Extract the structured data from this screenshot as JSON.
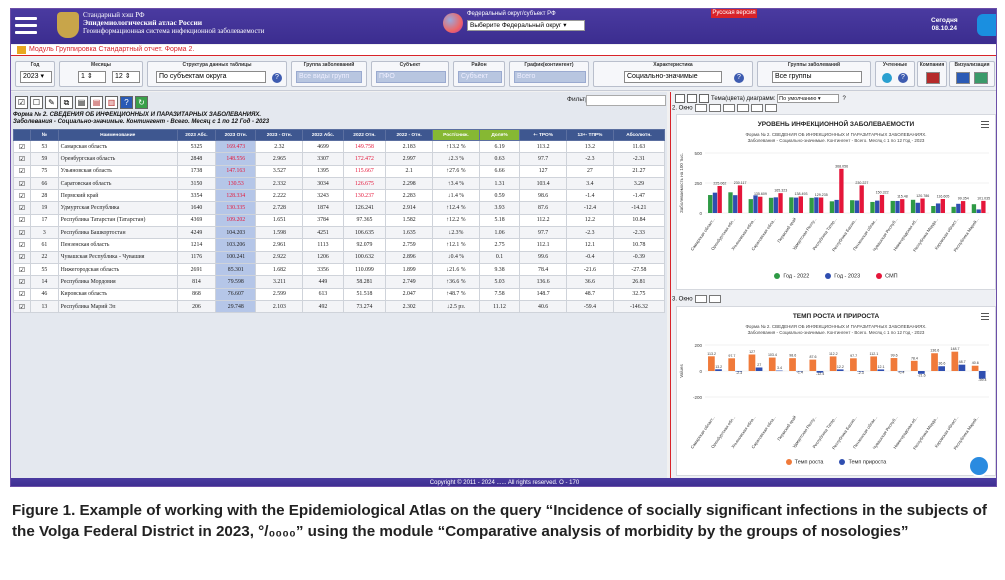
{
  "header": {
    "title_line1": "Стандарный хэш РФ",
    "title_line2": "Эпидемиологический атлас России",
    "title_line3": "Геоинформационная система инфекционной заболеваемости",
    "district_label": "Федеральный округ/субъект РФ",
    "district_select": "Выберите Федеральный округ",
    "badge": "Русская версия",
    "today_label": "Сегодня",
    "today_date": "08.10.24"
  },
  "module_bar": "Модуль Группировка Стандартный отчет. Форма 2.",
  "filters": {
    "year_label": "Год",
    "year": "2023",
    "month_label": "Месяцы",
    "month_from": "1",
    "month_to": "12",
    "structure_label": "Структура данных таблицы",
    "structure": "По субъектам округа",
    "disease_group_label": "Группа заболеваний",
    "disease_group": "Все виды групп",
    "subject_label": "Субъект",
    "subject": "ПФО",
    "district_label": "Район",
    "district": "Субъект",
    "grafic_label": "График(контингент)",
    "grafic": "Всего",
    "char_label": "Характеристика",
    "char": "Социально-значимые",
    "diseases_group2_label": "Группы заболеваний",
    "diseases_group2": "Все группы",
    "accounting_label": "Учтенные",
    "company_label": "Компания",
    "visualization_label": "Визуализация"
  },
  "table": {
    "filter_label": "Фильтр:",
    "form_title": "Форма № 2. СВЕДЕНИЯ ОБ ИНФЕКЦИОННЫХ И ПАРАЗИТАРНЫХ ЗАБОЛЕВАНИЯХ.",
    "form_subtitle": "Заболевания - Социально-значимые. Контингент - Всего. Месяц с 1 по 12 Год - 2023",
    "columns": [
      "",
      "№",
      "Наименование",
      "2023 Абс.",
      "2023 Отн.",
      "2023 - Отн.",
      "2022 Абс.",
      "2022 Отн.",
      "2022 - Отн.",
      "Рост/сниж.",
      "Доля%",
      "+- ТРО%",
      "13+- ТПР%",
      "Абсолютн."
    ],
    "rows": [
      [
        "53",
        "Самарская область",
        "5325",
        "169.473",
        "2.32",
        "4699",
        "149.758",
        "2.183",
        "↑13.2 %",
        "6.19",
        "113.2",
        "13.2",
        "11.63"
      ],
      [
        "59",
        "Оренбургская область",
        "2848",
        "148.556",
        "2.965",
        "3307",
        "172.472",
        "2.997",
        "↓2.3 %",
        "0.63",
        "97.7",
        "-2.3",
        "-2.31"
      ],
      [
        "75",
        "Ульяновская область",
        "1738",
        "147.163",
        "3.527",
        "1395",
        "115.667",
        "2.1",
        "↑27.6 %",
        "6.66",
        "127",
        "27",
        "21.27"
      ],
      [
        "66",
        "Саратовская область",
        "3150",
        "130.53",
        "2.332",
        "3034",
        "126.675",
        "2.298",
        "↑3.4 %",
        "1.31",
        "103.4",
        "3.4",
        "3.29"
      ],
      [
        "28",
        "Пермский край",
        "3354",
        "128.334",
        "2.222",
        "3243",
        "130.237",
        "2.283",
        "↓1.4 %",
        "0.59",
        "98.6",
        "-1.4",
        "-1.47"
      ],
      [
        "19",
        "Удмуртская Республика",
        "1640",
        "130.335",
        "2.728",
        "1874",
        "126.241",
        "2.914",
        "↑12.4 %",
        "3.93",
        "87.6",
        "-12.4",
        "-14.21"
      ],
      [
        "17",
        "Республика Татарстан (Татарстан)",
        "4369",
        "109.202",
        "1.651",
        "3784",
        "97.365",
        "1.582",
        "↑12.2 %",
        "5.18",
        "112.2",
        "12.2",
        "10.84"
      ],
      [
        "3",
        "Республика Башкортостан",
        "4249",
        "104.203",
        "1.598",
        "4251",
        "106.635",
        "1.635",
        "↓2.3%",
        "1.06",
        "97.7",
        "-2.3",
        "-2.33"
      ],
      [
        "61",
        "Пензенская область",
        "1214",
        "103.206",
        "2.961",
        "1113",
        "92.079",
        "2.759",
        "↑12.1 %",
        "2.75",
        "112.1",
        "12.1",
        "10.78"
      ],
      [
        "22",
        "Чувашская Республика - Чувашия",
        "1176",
        "100.241",
        "2.922",
        "1206",
        "100.632",
        "2.896",
        "↓0.4 %",
        "0.1",
        "99.6",
        "-0.4",
        "-0.39"
      ],
      [
        "55",
        "Нижегородская область",
        "2691",
        "85.301",
        "1.682",
        "3356",
        "110.099",
        "1.899",
        "↓21.6 %",
        "9.38",
        "78.4",
        "-21.6",
        "-27.58"
      ],
      [
        "14",
        "Республика Мордовия",
        "814",
        "79.598",
        "3.211",
        "449",
        "58.281",
        "2.749",
        "↑36.6 %",
        "5.03",
        "136.6",
        "36.6",
        "26.81"
      ],
      [
        "46",
        "Кировская область",
        "868",
        "76.607",
        "2.599",
        "613",
        "51.518",
        "2.047",
        "↑48.7 %",
        "7.58",
        "148.7",
        "48.7",
        "32.75"
      ],
      [
        "13",
        "Республика Марий Эл",
        "206",
        "29.748",
        "2.103",
        "492",
        "73.274",
        "2.302",
        "↓2.5 рз.",
        "11.12",
        "40.6",
        "-59.4",
        "-146.32"
      ]
    ]
  },
  "right_pane": {
    "toolbar_tail": "Тема(цвета) диаграмм:",
    "theme": "По умолчанию",
    "sub1_label": "2. Окно",
    "sub2_label": "3. Окно"
  },
  "chart1_text": {
    "title": "УРОВЕНЬ ИНФЕКЦИОННОЙ ЗАБОЛЕВАЕМОСТИ",
    "sub1": "Форма № 2. СВЕДЕНИЯ ОБ ИНФЕКЦИОННЫХ И ПАРАЗИТАРНЫХ ЗАБОЛЕВАНИЯХ.",
    "sub2": "Заболевания - Социально-значимые. Контингент - Всего. Месяц с 1 по 12 Год - 2023",
    "ylabel": "Заболеваемость на 100 тыс."
  },
  "chart2_text": {
    "title": "ТЕМП РОСТА И ПРИРОСТА",
    "sub1": "Форма № 2. СВЕДЕНИЯ ОБ ИНФЕКЦИОННЫХ И ПАРАЗИТАРНЫХ ЗАБОЛЕВАНИЯХ.",
    "sub2": "Заболевания - Социально-значимые. Контингент - Всего. Месяц с 1 по 12 Год - 2023",
    "ylabel": "Values"
  },
  "chart_data": [
    {
      "type": "bar",
      "title": "УРОВЕНЬ ИНФЕКЦИОННОЙ ЗАБОЛЕВАЕМОСТИ",
      "ylabel": "Заболеваемость на 100 тыс.",
      "ylim": [
        0,
        500
      ],
      "yticks": [
        0,
        250,
        500
      ],
      "categories": [
        "Самарская област...",
        "Оренбургская обл...",
        "Ульяновская обла...",
        "Саратовская обла...",
        "Пермский край",
        "Удмуртская Респу...",
        "Республика Татар...",
        "Республика Башко...",
        "Пензенская облас...",
        "Чувашская Респуб...",
        "Нижегородская об...",
        "Республика Мордо...",
        "Кировская област...",
        "Республика Марий..."
      ],
      "series": [
        {
          "name": "Год - 2022",
          "color": "#2e9a45",
          "values": [
            149.758,
            172.472,
            115.667,
            126.675,
            130.237,
            126.241,
            97.365,
            106.635,
            92.079,
            100.632,
            110.099,
            58.281,
            51.518,
            73.274
          ]
        },
        {
          "name": "Год - 2023",
          "color": "#2f4eb0",
          "values": [
            169.473,
            148.556,
            147.163,
            130.53,
            128.334,
            130.335,
            109.202,
            104.203,
            103.206,
            100.241,
            85.301,
            79.598,
            76.607,
            29.748
          ]
        },
        {
          "name": "СМП",
          "color": "#e5163a",
          "values": [
            225.062,
            230.117,
            135.609,
            165.323,
            138.493,
            129.235,
            368.056,
            230.227,
            150.32,
            115.48,
            120.786,
            116.605,
            99.354,
            101.035
          ]
        }
      ],
      "data_labels": [
        "225.062",
        "230.117",
        "135.609",
        "165.323",
        "138.493",
        "129.235",
        "368.056",
        "230.227",
        "150.322",
        "115.48",
        "120.786",
        "116.605",
        "99.354",
        "101.035"
      ],
      "legend": "bottom",
      "grid": true
    },
    {
      "type": "bar",
      "title": "ТЕМП РОСТА И ПРИРОСТА",
      "ylabel": "Values",
      "ylim": [
        -200,
        200
      ],
      "yticks": [
        -200,
        0,
        200
      ],
      "categories": [
        "Самарская област...",
        "Оренбургская обл...",
        "Ульяновская обла...",
        "Саратовская обла...",
        "Пермский край",
        "Удмуртская Респу...",
        "Республика Татар...",
        "Республика Башко...",
        "Пензенская облас...",
        "Чувашская Респуб...",
        "Нижегородская об...",
        "Республика Мордо...",
        "Кировская област...",
        "Республика Марий..."
      ],
      "series": [
        {
          "name": "Темп роста",
          "color": "#f07a3a",
          "values": [
            113.2,
            97.7,
            127,
            103.4,
            98.6,
            87.6,
            112.2,
            97.7,
            112.1,
            99.6,
            78.4,
            136.6,
            148.7,
            40.6
          ]
        },
        {
          "name": "Темп прироста",
          "color": "#2f4eb0",
          "values": [
            13.2,
            -2.3,
            27,
            3.4,
            -1.4,
            -12.4,
            12.2,
            -2.3,
            12.1,
            -0.4,
            -21.6,
            36.6,
            48.7,
            -59.4
          ]
        }
      ],
      "legend": "bottom",
      "grid": true
    }
  ],
  "footer": "Copyright © 2011 - 2024 ...... All rights reserved. О - 170",
  "caption": "Figure 1. Example of working with the Epidemiological Atlas on the query “Incidence of socially significant infections in the subjects of the Volga Federal District in 2023, °/₀₀₀₀” using the module “Comparative analysis of morbidity by the groups of nosologies”"
}
